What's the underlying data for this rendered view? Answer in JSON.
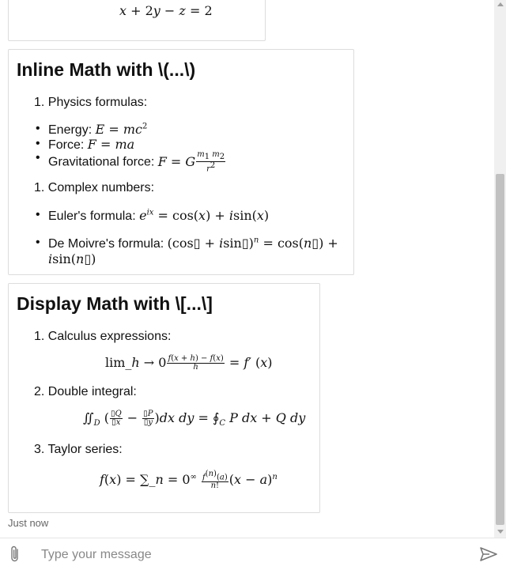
{
  "top_snippet": {
    "equation": "x + 2y − z = 2"
  },
  "inline_section": {
    "heading": "Inline Math with \\(...\\)",
    "item1_label": "Physics formulas:",
    "item1_number": "1.",
    "physics": [
      {
        "label": "Energy: ",
        "math": "E = mc²"
      },
      {
        "label": "Force: ",
        "math": "F = ma"
      },
      {
        "label": "Gravitational force: ",
        "math": "F = G m₁m₂ / r²"
      }
    ],
    "item2_number": "1.",
    "item2_label": "Complex numbers:",
    "complex": [
      {
        "label": "Euler's formula: ",
        "math": "e^{ix} = cos(x) + i sin(x)"
      },
      {
        "label": "De Moivre's formula: ",
        "math": "(cos + i sin)^n = cos(n) + i sin(n)"
      }
    ]
  },
  "display_section": {
    "heading": "Display Math with \\[...\\]",
    "items": [
      {
        "number": "1.",
        "label": "Calculus expressions:"
      },
      {
        "number": "2.",
        "label": "Double integral:"
      },
      {
        "number": "3.",
        "label": "Taylor series:"
      }
    ]
  },
  "timestamp": "Just now",
  "composer": {
    "placeholder": "Type your message"
  },
  "icons": {
    "attach": "paperclip-icon",
    "send": "send-icon"
  }
}
